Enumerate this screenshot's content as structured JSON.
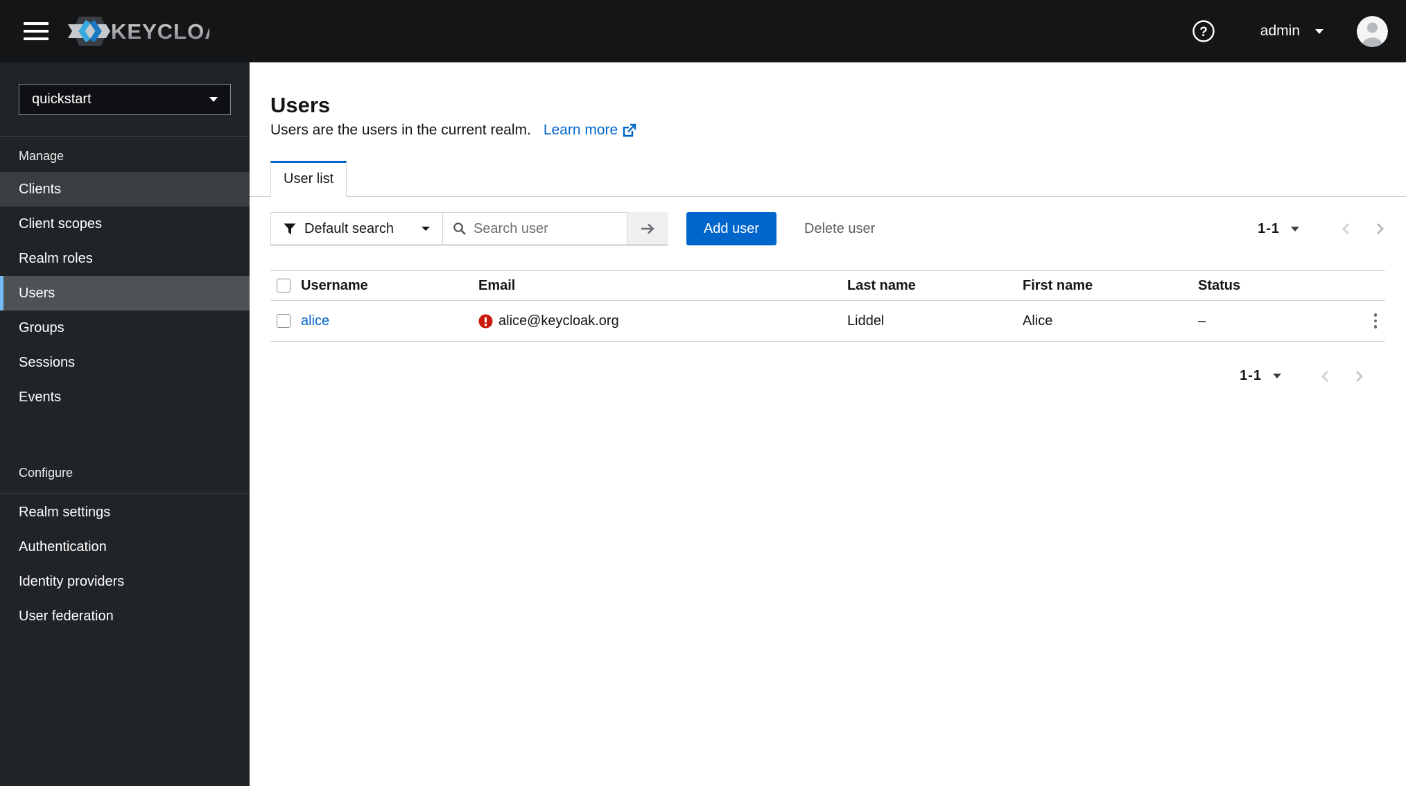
{
  "topbar": {
    "brand": "KEYCLOAK",
    "username": "admin"
  },
  "sidebar": {
    "realm": "quickstart",
    "manage_label": "Manage",
    "manage_items": [
      "Clients",
      "Client scopes",
      "Realm roles",
      "Users",
      "Groups",
      "Sessions",
      "Events"
    ],
    "configure_label": "Configure",
    "configure_items": [
      "Realm settings",
      "Authentication",
      "Identity providers",
      "User federation"
    ],
    "selected_item": "Users"
  },
  "main": {
    "title": "Users",
    "subtitle": "Users are the users in the current realm.",
    "learn_more_label": "Learn more",
    "tab_label": "User list",
    "toolbar": {
      "filter_label": "Default search",
      "search_placeholder": "Search user",
      "add_user_label": "Add user",
      "delete_user_label": "Delete user",
      "pagination_range": "1-1"
    },
    "table": {
      "columns": [
        "Username",
        "Email",
        "Last name",
        "First name",
        "Status"
      ],
      "rows": [
        {
          "username": "alice",
          "email": "alice@keycloak.org",
          "email_invalid": true,
          "last_name": "Liddel",
          "first_name": "Alice",
          "status": "–"
        }
      ]
    },
    "pagination_bottom_range": "1-1"
  },
  "colors": {
    "masthead_bg": "#131517",
    "sidebar_bg": "#212427",
    "accent_blue": "#0066cc",
    "error_red": "#c9190b",
    "selected_nav_border": "#73bcf7"
  }
}
